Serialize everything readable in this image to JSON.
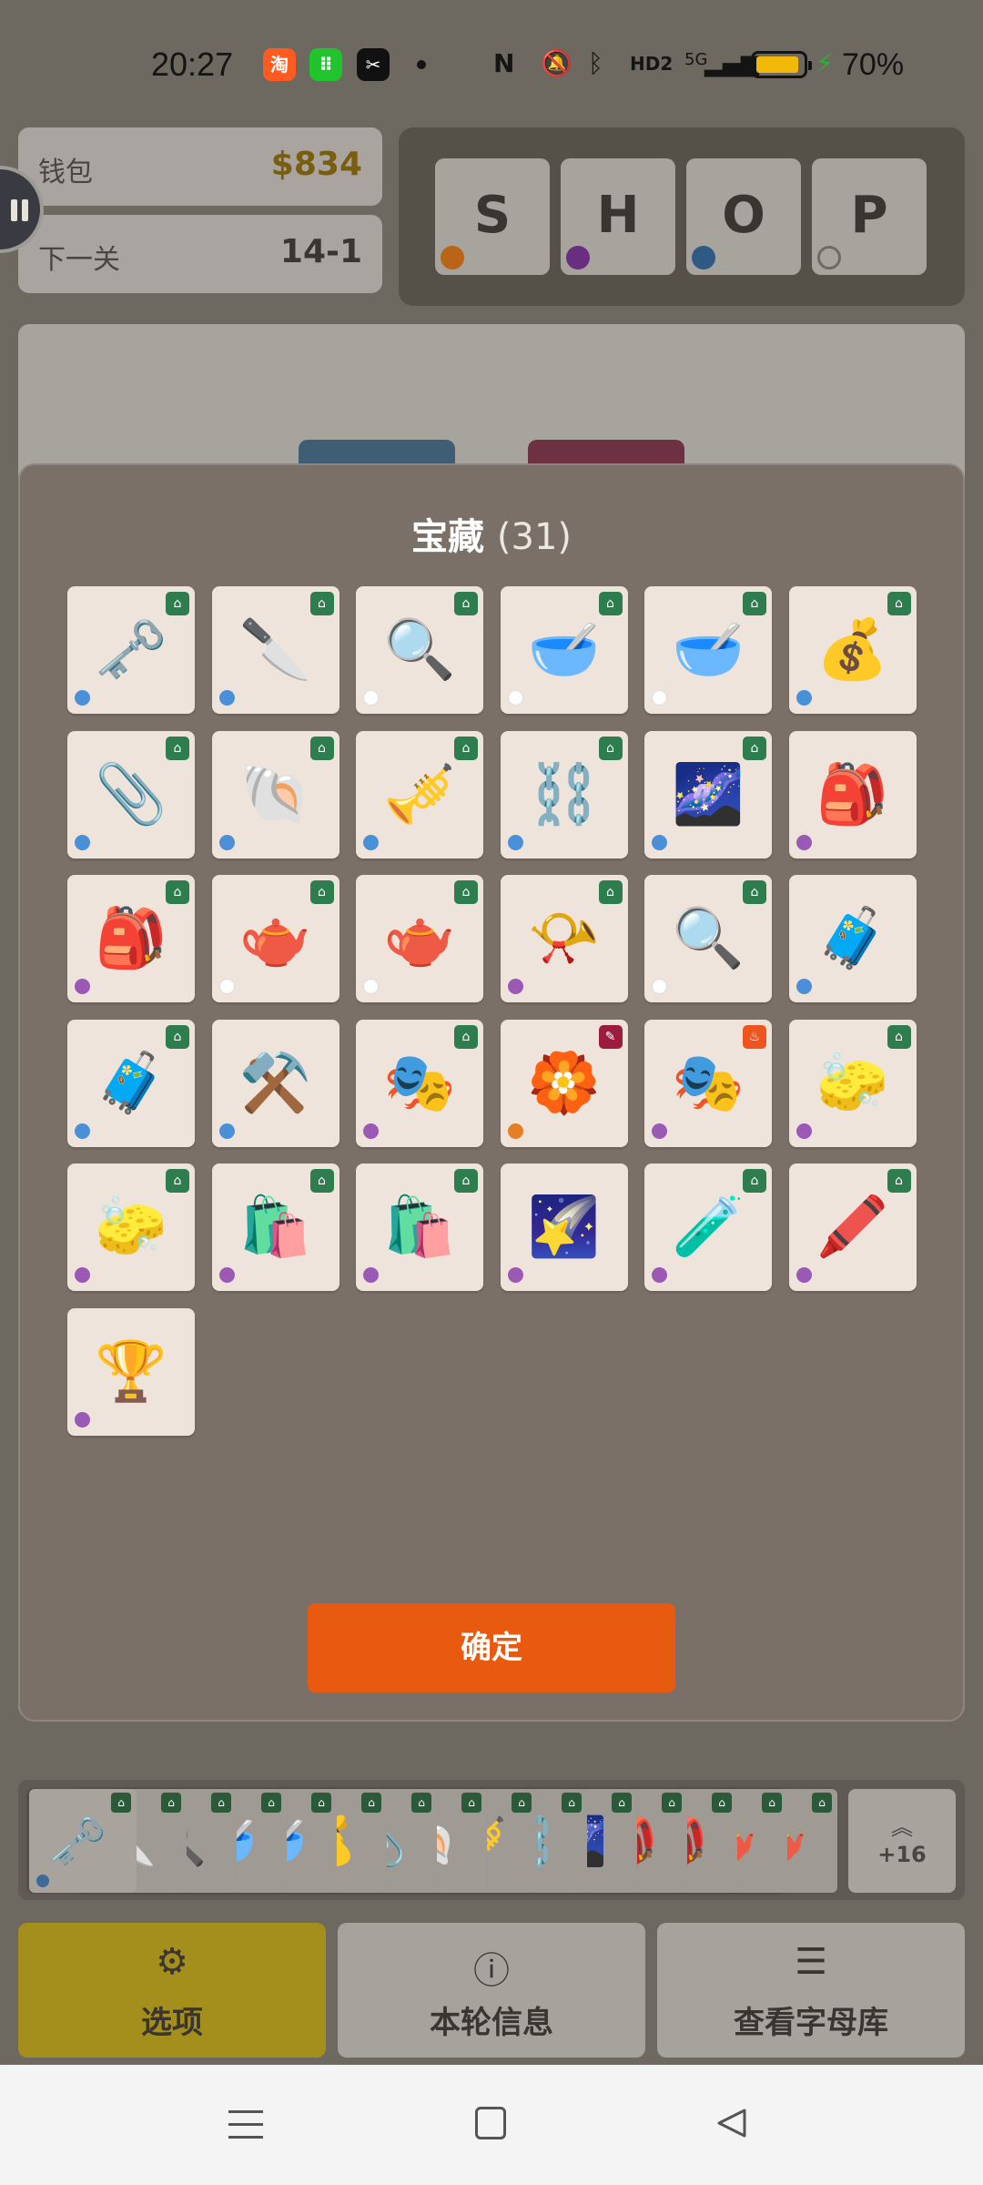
{
  "status_bar": {
    "time": "20:27",
    "apps": [
      {
        "name": "taobao-app-icon",
        "glyph": "淘",
        "color": "#ff5a1f"
      },
      {
        "name": "wechat-mini-icon",
        "glyph": "⠿",
        "color": "#22c42e"
      },
      {
        "name": "capcut-app-icon",
        "glyph": "✂",
        "color": "#111111"
      }
    ],
    "network": "5G",
    "hd": "HD2",
    "battery_percent": "70%",
    "battery_level": 0.7
  },
  "wallet": {
    "label": "钱包",
    "value": "$834",
    "value_color": "#7a5e10"
  },
  "next_level": {
    "label": "下一关",
    "value": "14-1"
  },
  "shop": {
    "tiles": [
      {
        "letter": "S",
        "dot_color": "#b96416"
      },
      {
        "letter": "H",
        "dot_color": "#6a2e80"
      },
      {
        "letter": "O",
        "dot_color": "#2f5a86"
      },
      {
        "letter": "P",
        "dot_color": "none"
      }
    ]
  },
  "modal": {
    "title": "宝藏",
    "count": "(31)",
    "confirm_label": "确定",
    "items": [
      {
        "emoji": "🗝️",
        "dot": "#4a90d9",
        "badge": "bag"
      },
      {
        "emoji": "🔪",
        "dot": "#4a90d9",
        "badge": "bag"
      },
      {
        "emoji": "🔍",
        "dot": "#ffffff",
        "badge": "bag"
      },
      {
        "emoji": "🥣",
        "dot": "#ffffff",
        "badge": "bag"
      },
      {
        "emoji": "🥣",
        "dot": "#ffffff",
        "badge": "bag"
      },
      {
        "emoji": "💰",
        "dot": "#4a90d9",
        "badge": "bag"
      },
      {
        "emoji": "📎",
        "dot": "#4a90d9",
        "badge": "bag"
      },
      {
        "emoji": "🐚",
        "dot": "#4a90d9",
        "badge": "bag"
      },
      {
        "emoji": "🎺",
        "dot": "#4a90d9",
        "badge": "bag"
      },
      {
        "emoji": "⛓️",
        "dot": "#4a90d9",
        "badge": "bag"
      },
      {
        "emoji": "🌌",
        "dot": "#4a90d9",
        "badge": "bag"
      },
      {
        "emoji": "🎒",
        "dot": "#9b59b6",
        "badge": "none"
      },
      {
        "emoji": "🎒",
        "dot": "#9b59b6",
        "badge": "bag"
      },
      {
        "emoji": "🫖",
        "dot": "#ffffff",
        "badge": "bag"
      },
      {
        "emoji": "🫖",
        "dot": "#ffffff",
        "badge": "bag"
      },
      {
        "emoji": "📯",
        "dot": "#9b59b6",
        "badge": "bag"
      },
      {
        "emoji": "🔍",
        "dot": "#ffffff",
        "badge": "bag"
      },
      {
        "emoji": "🧳",
        "dot": "#4a90d9",
        "badge": "none"
      },
      {
        "emoji": "🧳",
        "dot": "#4a90d9",
        "badge": "bag"
      },
      {
        "emoji": "⚒️",
        "dot": "#4a90d9",
        "badge": "none"
      },
      {
        "emoji": "🎭",
        "dot": "#9b59b6",
        "badge": "bag"
      },
      {
        "emoji": "🏵️",
        "dot": "#e67e22",
        "badge": "wrench"
      },
      {
        "emoji": "🎭",
        "dot": "#9b59b6",
        "badge": "fire"
      },
      {
        "emoji": "🧽",
        "dot": "#9b59b6",
        "badge": "bag"
      },
      {
        "emoji": "🧽",
        "dot": "#9b59b6",
        "badge": "bag"
      },
      {
        "emoji": "🛍️",
        "dot": "#9b59b6",
        "badge": "bag"
      },
      {
        "emoji": "🛍️",
        "dot": "#9b59b6",
        "badge": "bag"
      },
      {
        "emoji": "🌠",
        "dot": "#9b59b6",
        "badge": "none"
      },
      {
        "emoji": "🧪",
        "dot": "#9b59b6",
        "badge": "bag"
      },
      {
        "emoji": "🖍️",
        "dot": "#9b59b6",
        "badge": "bag"
      },
      {
        "emoji": "🏆",
        "dot": "#9b59b6",
        "badge": "none"
      }
    ]
  },
  "inventory_strip": {
    "cards": [
      "🗝️",
      "🔪",
      "🔍",
      "🥣",
      "🥣",
      "💰",
      "📎",
      "🐚",
      "🎺",
      "⛓️",
      "🌌",
      "🎒",
      "🎒",
      "🫖",
      "🫖"
    ],
    "more_label": "+16"
  },
  "bottom_buttons": [
    {
      "icon": "⚙",
      "label": "选项"
    },
    {
      "icon": "ⓘ",
      "label": "本轮信息"
    },
    {
      "icon": "☰",
      "label": "查看字母库"
    }
  ],
  "badge_colors": {
    "bag": "#2e7d4f",
    "wrench": "#9c1b3e",
    "fire": "#f0541e"
  }
}
